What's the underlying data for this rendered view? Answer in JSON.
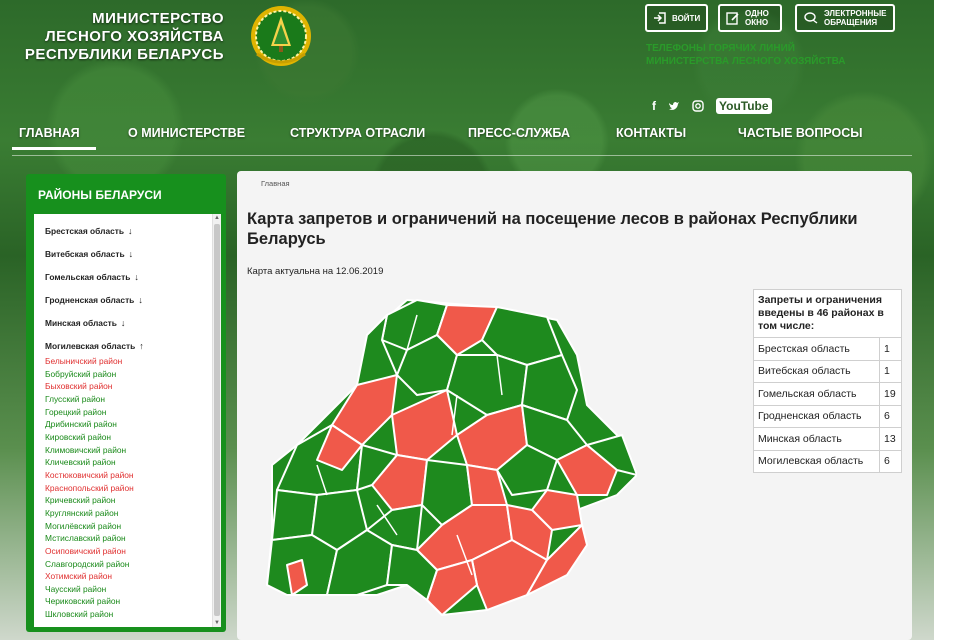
{
  "header": {
    "ministry_line1": "МИНИСТЕРСТВО",
    "ministry_line2": "ЛЕСНОГО ХОЗЯЙСТВА",
    "ministry_line3": "РЕСПУБЛИКИ БЕЛАРУСЬ",
    "login_label": "ВОЙТИ",
    "one_window_line1": "ОДНО",
    "one_window_line2": "ОКНО",
    "appeals_line1": "ЭЛЕКТРОННЫЕ",
    "appeals_line2": "ОБРАЩЕНИЯ",
    "hotlines_line1": "ТЕЛЕФОНЫ ГОРЯЧИХ ЛИНИЙ",
    "hotlines_line2": "МИНИСТЕРСТВА ЛЕСНОГО ХОЗЯЙСТВА",
    "socials": {
      "facebook": "f",
      "twitter": "twitter-icon",
      "instagram": "instagram-icon",
      "youtube": "YouTube"
    }
  },
  "nav": {
    "items": [
      "ГЛАВНАЯ",
      "О МИНИСТЕРСТВЕ",
      "СТРУКТУРА ОТРАСЛИ",
      "ПРЕСС-СЛУЖБА",
      "КОНТАКТЫ",
      "ЧАСТЫЕ ВОПРОСЫ"
    ],
    "active": "ГЛАВНАЯ"
  },
  "sidebar": {
    "title": "РАЙОНЫ БЕЛАРУСИ",
    "regions": [
      {
        "label": "Брестская область",
        "arrow": "↓"
      },
      {
        "label": "Витебская область",
        "arrow": "↓"
      },
      {
        "label": "Гомельская область",
        "arrow": "↓"
      },
      {
        "label": "Гродненская область",
        "arrow": "↓"
      },
      {
        "label": "Минская область",
        "arrow": "↓"
      },
      {
        "label": "Могилевская область",
        "arrow": "↑"
      }
    ],
    "districts": [
      {
        "label": "Белыничский район",
        "restricted": true
      },
      {
        "label": "Бобруйский район",
        "restricted": false
      },
      {
        "label": "Быховский район",
        "restricted": true
      },
      {
        "label": "Глусский район",
        "restricted": false
      },
      {
        "label": "Горецкий район",
        "restricted": false
      },
      {
        "label": "Дрибинский район",
        "restricted": false
      },
      {
        "label": "Кировский район",
        "restricted": false
      },
      {
        "label": "Климовичский район",
        "restricted": false
      },
      {
        "label": "Кличевский район",
        "restricted": false
      },
      {
        "label": "Костюковичский район",
        "restricted": true
      },
      {
        "label": "Краснопольский район",
        "restricted": true
      },
      {
        "label": "Кричевский район",
        "restricted": false
      },
      {
        "label": "Круглянский район",
        "restricted": false
      },
      {
        "label": "Могилёвский район",
        "restricted": false
      },
      {
        "label": "Мстиславский район",
        "restricted": false
      },
      {
        "label": "Осиповичский район",
        "restricted": true
      },
      {
        "label": "Славгородский район",
        "restricted": false
      },
      {
        "label": "Хотимский район",
        "restricted": true
      },
      {
        "label": "Чаусский район",
        "restricted": false
      },
      {
        "label": "Чериковский район",
        "restricted": false
      },
      {
        "label": "Шкловский район",
        "restricted": false
      }
    ],
    "colors": {
      "restricted": "#e03030",
      "open": "#1a8a1a"
    }
  },
  "main": {
    "breadcrumb": "Главная",
    "title": "Карта запретов и ограничений на посещение лесов в районах Республики Беларусь",
    "actual_date": "Карта актуальна на 12.06.2019",
    "map_colors": {
      "restricted": "#f0594a",
      "open": "#1e8a1e",
      "border": "#ffffff"
    },
    "stats": {
      "header": "Запреты и ограничения введены в 46 районах в том числе:",
      "rows": [
        {
          "region": "Брестская область",
          "count": "1"
        },
        {
          "region": "Витебская область",
          "count": "1"
        },
        {
          "region": "Гомельская область",
          "count": "19"
        },
        {
          "region": "Гродненская область",
          "count": "6"
        },
        {
          "region": "Минская область",
          "count": "13"
        },
        {
          "region": "Могилевская область",
          "count": "6"
        }
      ]
    }
  }
}
